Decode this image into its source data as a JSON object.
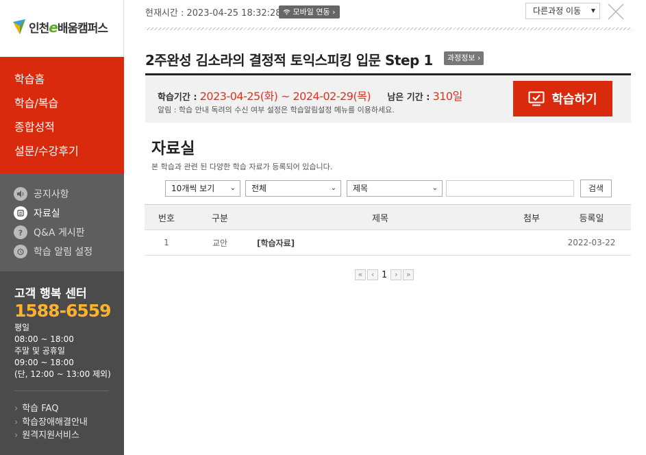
{
  "logo": {
    "prefix": "인천",
    "e": "e",
    "suffix": "배움캠퍼스"
  },
  "main_menu": [
    {
      "label": "학습홈"
    },
    {
      "label": "학습/복습"
    },
    {
      "label": "종합성적"
    },
    {
      "label": "설문/수강후기"
    }
  ],
  "sub_menu": [
    {
      "label": "공지사항",
      "icon": "speaker-icon",
      "active": false
    },
    {
      "label": "자료실",
      "icon": "archive-icon",
      "active": true
    },
    {
      "label": "Q&A 게시판",
      "icon": "question-icon",
      "active": false
    },
    {
      "label": "학습 알림 설정",
      "icon": "alarm-clock-icon",
      "active": false
    }
  ],
  "customer_center": {
    "title": "고객 행복 센터",
    "phone": "1588-6559",
    "hours": [
      "평일",
      "08:00 ~ 18:00",
      "주말 및 공휴일",
      "09:00 ~ 18:00",
      "(단, 12:00 ~ 13:00 제외)"
    ],
    "links": [
      "학습 FAQ",
      "학습장애해결안내",
      "원격지원서비스"
    ]
  },
  "topbar": {
    "current_time": "현재시간 : 2023-04-25 18:32:28",
    "mobile_button": "모바일 연동",
    "other_course": "다른과정 이동"
  },
  "course": {
    "title": "2주완성 김소라의 결정적 토익스피킹 입문 Step 1",
    "info_button": "과정정보",
    "period_label": "학습기간 :",
    "period_value": "2023-04-25(화) ~ 2024-02-29(목)",
    "remain_label": "남은 기간 :",
    "remain_value": "310일",
    "notice": "알림 : 학습 안내 독려의 수신 여부 설정은 학습알림설정 메뉴를 이용하세요.",
    "study_button": "학습하기"
  },
  "board": {
    "title": "자료실",
    "description": "본 학습과 관련 된 다양한 학습 자료가 등록되어 있습니다.",
    "filters": {
      "page_size": "10개씩 보기",
      "category": "전체",
      "search_field": "제목",
      "search_value": "",
      "search_button": "검색"
    },
    "columns": [
      "번호",
      "구분",
      "제목",
      "첨부",
      "등록일"
    ],
    "rows": [
      {
        "no": "1",
        "category": "교안",
        "title": "[학습자료]",
        "attachment": "",
        "date": "2022-03-22"
      }
    ],
    "pagination": {
      "current": "1"
    }
  },
  "colors": {
    "accent_red": "#d92a0d",
    "sidebar_dark": "#5e5e5e",
    "phone_orange": "#ffb32c",
    "period_red": "#e0321d"
  }
}
